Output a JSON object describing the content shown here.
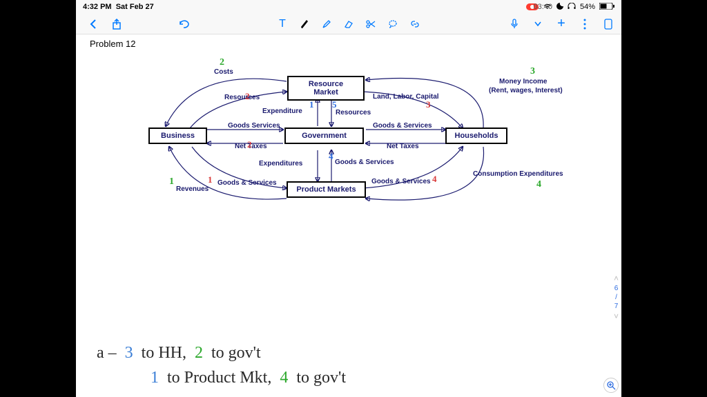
{
  "status": {
    "time": "4:32 PM",
    "date": "Sat Feb 27",
    "battery": "54%"
  },
  "toolbar": {
    "elapsed": "03:40"
  },
  "page": {
    "title": "Problem 12"
  },
  "diagram": {
    "boxes": {
      "resource_market": "Resource Market",
      "business": "Business",
      "government": "Government",
      "households": "Households",
      "product_markets": "Product Markets"
    },
    "labels": {
      "costs": "Costs",
      "resources1": "Resources",
      "resources2": "Resources",
      "expenditure": "Expenditure",
      "land_labor_capital": "Land, Labor, Capital",
      "money_income": "Money Income",
      "money_income_sub": "(Rent, wages, Interest)",
      "goods_services1": "Goods Services",
      "goods_services2": "Goods & Services",
      "goods_services3": "Goods & Services",
      "goods_services4": "Goods & Services",
      "goods_services5": "Goods & Services",
      "net_taxes1": "Net Taxes",
      "net_taxes2": "Net Taxes",
      "expenditures": "Expenditures",
      "revenues": "Revenues",
      "consumption_exp": "Consumption Expenditures"
    },
    "annotations": {
      "g1": "2",
      "g2": "1",
      "g3": "3",
      "g4": "4",
      "r1": "2",
      "r2": "1",
      "r3": "2",
      "r4": "3",
      "r5": "4",
      "b1": "1",
      "b2": "5",
      "b3": "4"
    }
  },
  "handwriting": {
    "line1_prefix": "a –",
    "line1_a": "3",
    "line1_b": "to HH,",
    "line1_c": "2",
    "line1_d": "to gov't",
    "line2_a": "1",
    "line2_b": "to Product Mkt,",
    "line2_c": "4",
    "line2_d": "to gov't"
  },
  "nav": {
    "page_current": "6",
    "page_sep": "/",
    "page_total": "7"
  }
}
